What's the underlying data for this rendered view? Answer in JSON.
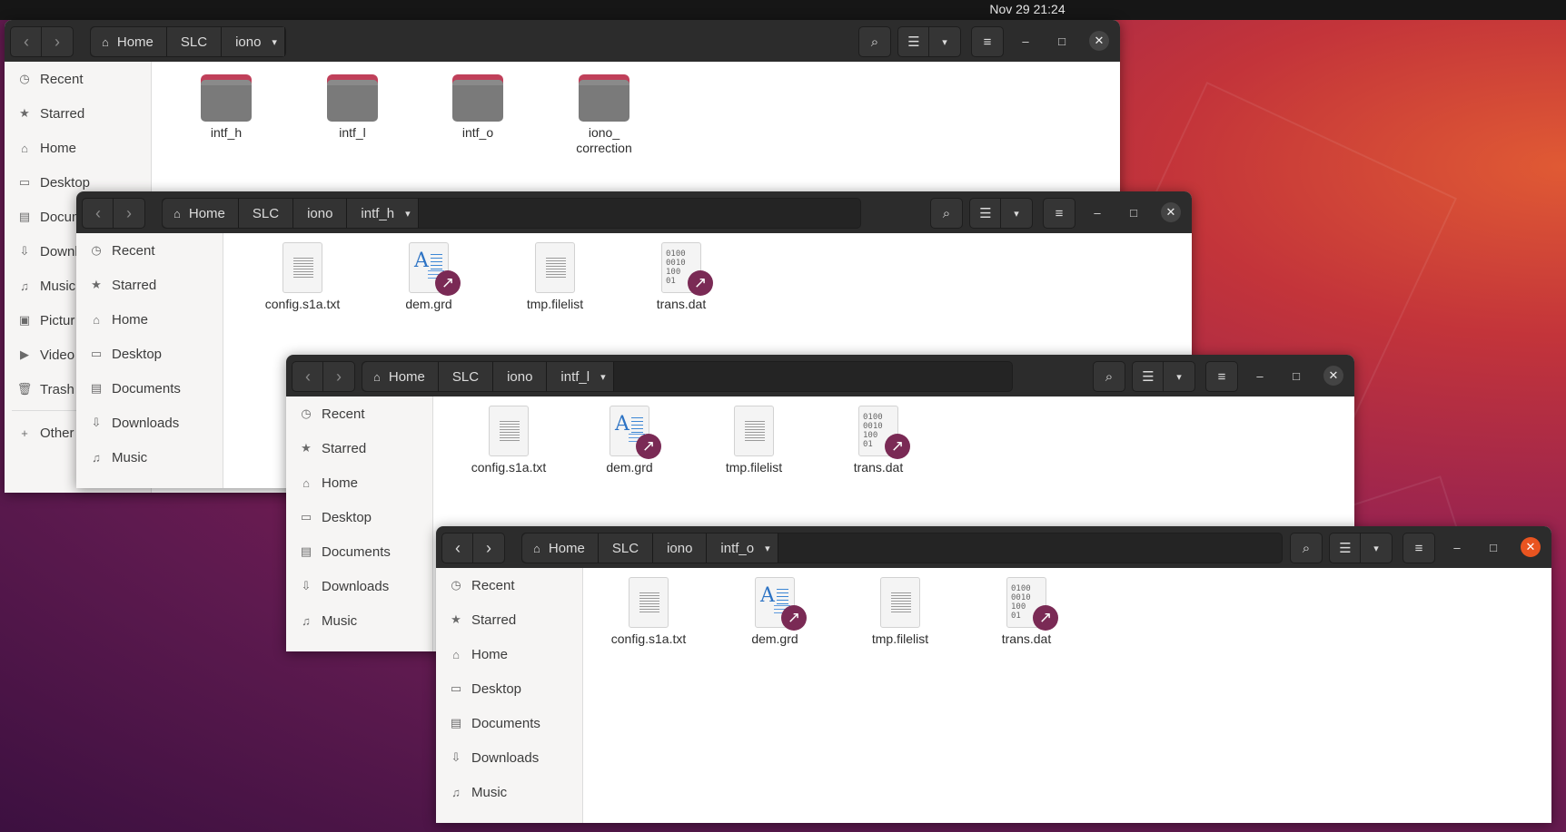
{
  "topbar": {
    "clock": "Nov 29  21:24"
  },
  "icons": {
    "back": "‹",
    "forward": "›",
    "home": "⌂",
    "dropdown": "▾",
    "search": "⌕",
    "list": "☰",
    "menu": "≡",
    "minimize": "–",
    "maximize": "□",
    "close": "✕",
    "link": "↗"
  },
  "window1": {
    "path": [
      "Home",
      "SLC",
      "iono"
    ],
    "sidebar": [
      "Recent",
      "Starred",
      "Home",
      "Desktop",
      "Docum",
      "Downl",
      "Music",
      "Pictur",
      "Video",
      "Trash",
      "Other"
    ],
    "files": [
      {
        "name": "intf_h",
        "type": "folder"
      },
      {
        "name": "intf_l",
        "type": "folder"
      },
      {
        "name": "intf_o",
        "type": "folder"
      },
      {
        "name": "iono_\ncorrection",
        "type": "folder"
      }
    ]
  },
  "window2": {
    "path": [
      "Home",
      "SLC",
      "iono",
      "intf_h"
    ],
    "sidebar": [
      "Recent",
      "Starred",
      "Home",
      "Desktop",
      "Documents",
      "Downloads",
      "Music"
    ],
    "files": [
      {
        "name": "config.s1a.txt",
        "type": "text"
      },
      {
        "name": "dem.grd",
        "type": "link-doc"
      },
      {
        "name": "tmp.filelist",
        "type": "text"
      },
      {
        "name": "trans.dat",
        "type": "link-bin"
      }
    ]
  },
  "window3": {
    "path": [
      "Home",
      "SLC",
      "iono",
      "intf_l"
    ],
    "sidebar": [
      "Recent",
      "Starred",
      "Home",
      "Desktop",
      "Documents",
      "Downloads",
      "Music"
    ],
    "files": [
      {
        "name": "config.s1a.txt",
        "type": "text"
      },
      {
        "name": "dem.grd",
        "type": "link-doc"
      },
      {
        "name": "tmp.filelist",
        "type": "text"
      },
      {
        "name": "trans.dat",
        "type": "link-bin"
      }
    ]
  },
  "window4": {
    "path": [
      "Home",
      "SLC",
      "iono",
      "intf_o"
    ],
    "sidebar": [
      "Recent",
      "Starred",
      "Home",
      "Desktop",
      "Documents",
      "Downloads",
      "Music"
    ],
    "files": [
      {
        "name": "config.s1a.txt",
        "type": "text"
      },
      {
        "name": "dem.grd",
        "type": "link-doc"
      },
      {
        "name": "tmp.filelist",
        "type": "text"
      },
      {
        "name": "trans.dat",
        "type": "link-bin"
      }
    ]
  },
  "sidebar_icons": [
    "clock-icon",
    "star-icon",
    "home-icon",
    "desktop-icon",
    "document-icon",
    "download-icon",
    "music-icon",
    "pictures-icon",
    "video-icon",
    "trash-icon",
    "plus-icon"
  ],
  "binary_glyph": "0100\n0010\n100\n01"
}
